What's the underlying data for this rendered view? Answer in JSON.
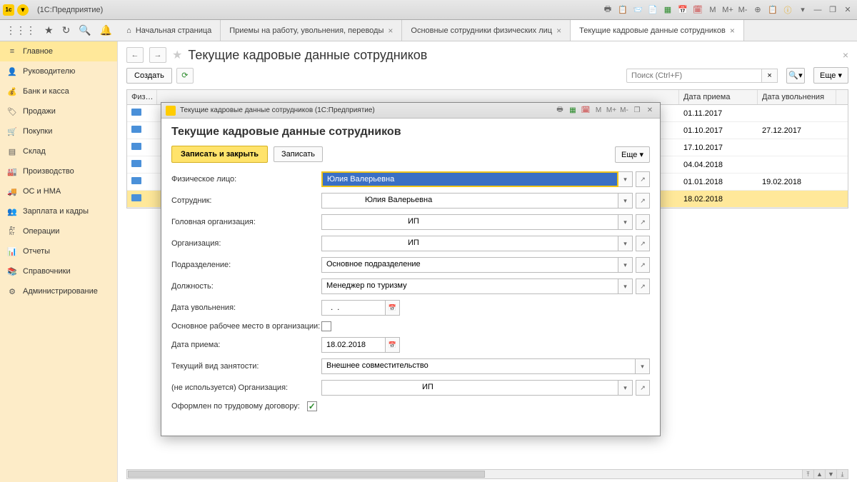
{
  "titlebar": {
    "app_label": "(1С:Предприятие)",
    "right_icons": [
      "🖶",
      "📋",
      "✉",
      "📄",
      "📊",
      "📅",
      "🗓",
      "M",
      "M+",
      "M-",
      "⊕",
      "📋",
      "ℹ",
      "▾",
      "—",
      "❐",
      "✕"
    ]
  },
  "toolbar": {
    "tabs": [
      {
        "label": "Начальная страница",
        "home": true
      },
      {
        "label": "Приемы на работу, увольнения, переводы",
        "closable": true
      },
      {
        "label": "Основные сотрудники физических лиц",
        "closable": true
      },
      {
        "label": "Текущие кадровые данные сотрудников",
        "closable": true,
        "active": true
      }
    ]
  },
  "sidebar": [
    {
      "icon": "≡",
      "label": "Главное",
      "active": true
    },
    {
      "icon": "👤",
      "label": "Руководителю"
    },
    {
      "icon": "🏦",
      "label": "Банк и касса"
    },
    {
      "icon": "🏷",
      "label": "Продажи"
    },
    {
      "icon": "🛒",
      "label": "Покупки"
    },
    {
      "icon": "📦",
      "label": "Склад"
    },
    {
      "icon": "🏭",
      "label": "Производство"
    },
    {
      "icon": "🚚",
      "label": "ОС и НМА"
    },
    {
      "icon": "👥",
      "label": "Зарплата и кадры"
    },
    {
      "icon": "Дт Кт",
      "label": "Операции"
    },
    {
      "icon": "📊",
      "label": "Отчеты"
    },
    {
      "icon": "📚",
      "label": "Справочники"
    },
    {
      "icon": "⚙",
      "label": "Администрирование"
    }
  ],
  "page": {
    "title": "Текущие кадровые данные сотрудников",
    "create": "Создать",
    "search_placeholder": "Поиск (Ctrl+F)",
    "more": "Еще ▾"
  },
  "table": {
    "headers": {
      "phys": "Физ…",
      "hire": "Дата приема",
      "fire": "Дата увольнения"
    },
    "rows": [
      {
        "hire": "01.11.2017",
        "fire": ""
      },
      {
        "hire": "01.10.2017",
        "fire": "27.12.2017"
      },
      {
        "hire": "17.10.2017",
        "fire": ""
      },
      {
        "hire": "04.04.2018",
        "fire": ""
      },
      {
        "hire": "01.01.2018",
        "fire": "19.02.2018"
      },
      {
        "hire": "18.02.2018",
        "fire": "",
        "sel": true
      }
    ]
  },
  "modal": {
    "window_title": "Текущие кадровые данные сотрудников  (1С:Предприятие)",
    "title": "Текущие кадровые данные сотрудников",
    "save_close": "Записать и закрыть",
    "save": "Записать",
    "more": "Еще ▾",
    "fields": {
      "person_label": "Физическое лицо:",
      "person_value": "Юлия Валерьевна",
      "employee_label": "Сотрудник:",
      "employee_value": "Юлия Валерьевна",
      "headorg_label": "Головная организация:",
      "headorg_value": "ИП",
      "org_label": "Организация:",
      "org_value": "ИП",
      "dept_label": "Подразделение:",
      "dept_value": "Основное подразделение",
      "position_label": "Должность:",
      "position_value": "Менеджер по туризму",
      "firedate_label": "Дата увольнения:",
      "firedate_value": "  .  .",
      "mainjob_label": "Основное рабочее место в организации:",
      "hiredate_label": "Дата приема:",
      "hiredate_value": "18.02.2018",
      "emptype_label": "Текущий вид занятости:",
      "emptype_value": "Внешнее совместительство",
      "unused_org_label": "(не используется) Организация:",
      "unused_org_value": "ИП",
      "contract_label": "Оформлен по трудовому договору:"
    }
  }
}
